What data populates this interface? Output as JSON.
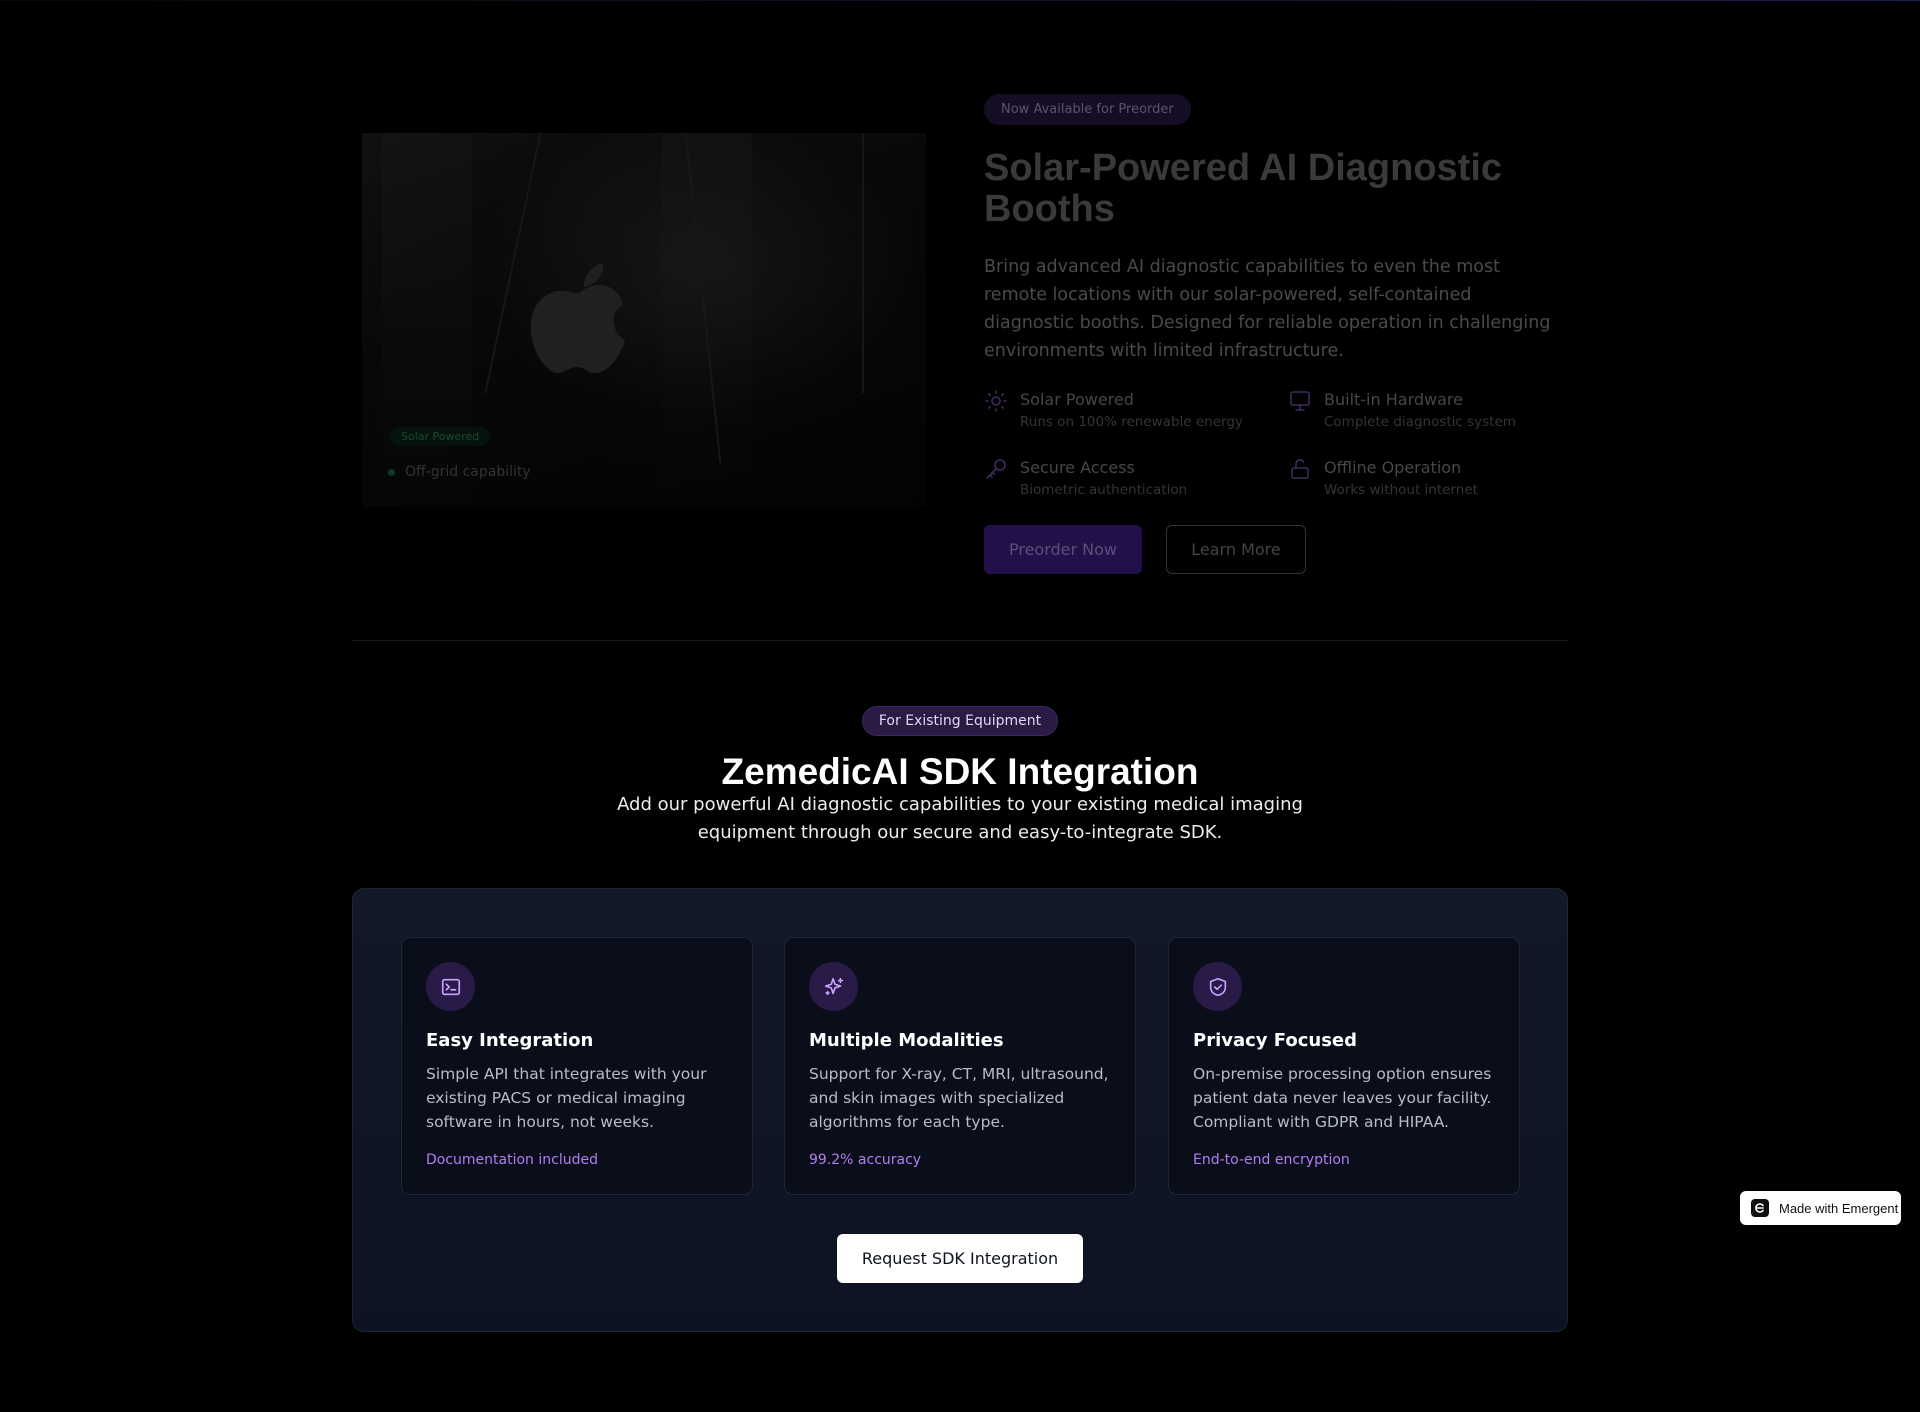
{
  "hero": {
    "image_badge": "Solar Powered",
    "image_status": "Off-grid capability",
    "badge": "Now Available for Preorder",
    "title": "Solar-Powered AI Diagnostic Booths",
    "description": "Bring advanced AI diagnostic capabilities to even the most remote locations with our solar-powered, self-contained diagnostic booths. Designed for reliable operation in challenging environments with limited infrastructure.",
    "features": [
      {
        "icon": "sun-icon",
        "title": "Solar Powered",
        "subtitle": "Runs on 100% renewable energy"
      },
      {
        "icon": "monitor-icon",
        "title": "Built-in Hardware",
        "subtitle": "Complete diagnostic system"
      },
      {
        "icon": "key-icon",
        "title": "Secure Access",
        "subtitle": "Biometric authentication"
      },
      {
        "icon": "unlock-icon",
        "title": "Offline Operation",
        "subtitle": "Works without internet"
      }
    ],
    "preorder_label": "Preorder Now",
    "learn_more_label": "Learn More"
  },
  "sdk": {
    "badge": "For Existing Equipment",
    "title": "ZemedicAI SDK Integration",
    "description": "Add our powerful AI diagnostic capabilities to your existing medical imaging equipment through our secure and easy-to-integrate SDK.",
    "cards": [
      {
        "icon": "terminal-icon",
        "title": "Easy Integration",
        "description": "Simple API that integrates with your existing PACS or medical imaging software in hours, not weeks.",
        "tag": "Documentation included"
      },
      {
        "icon": "sparkles-icon",
        "title": "Multiple Modalities",
        "description": "Support for X-ray, CT, MRI, ultrasound, and skin images with specialized algorithms for each type.",
        "tag": "99.2% accuracy"
      },
      {
        "icon": "shield-check-icon",
        "title": "Privacy Focused",
        "description": "On-premise processing option ensures patient data never leaves your facility. Compliant with GDPR and HIPAA.",
        "tag": "End-to-end encryption"
      }
    ],
    "cta_label": "Request SDK Integration"
  },
  "made_with": "Made with Emergent",
  "colors": {
    "accent_purple": "#b47cf3",
    "badge_purple_bg": "#2a1a44",
    "panel_bg": "#111828",
    "card_bg": "#0a0e1a"
  }
}
